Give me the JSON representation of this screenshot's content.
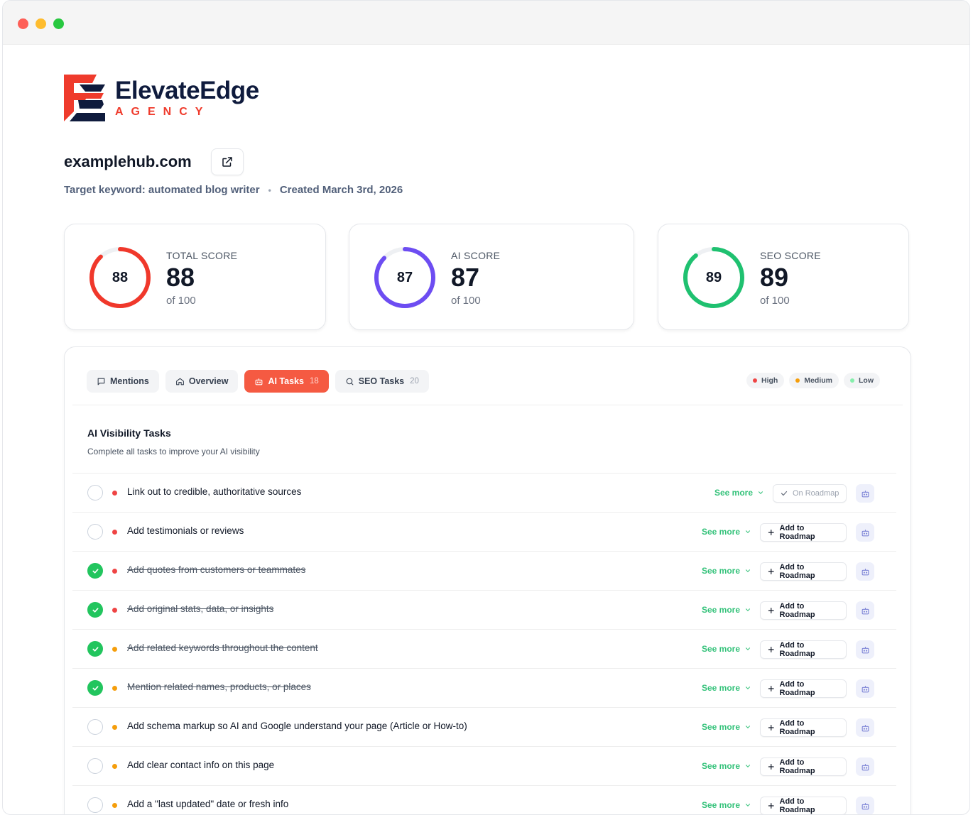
{
  "window": {
    "title": ""
  },
  "brand": {
    "name": "ElevateEdge",
    "tagline": "AGENCY"
  },
  "site": {
    "domain": "examplehub.com",
    "target_keyword": "Target keyword: automated blog writer",
    "created": "Created March 3rd, 2026"
  },
  "scores": [
    {
      "label": "TOTAL SCORE",
      "value": "88",
      "of": "of 100",
      "percent": 88,
      "color": "#f0382b"
    },
    {
      "label": "AI SCORE",
      "value": "87",
      "of": "of 100",
      "percent": 87,
      "color": "#6d4df2"
    },
    {
      "label": "SEO SCORE",
      "value": "89",
      "of": "of 100",
      "percent": 89,
      "color": "#1fc170"
    }
  ],
  "tabs": [
    {
      "label": "Mentions",
      "count": "",
      "icon": "chat-bubble-icon",
      "active": false
    },
    {
      "label": "Overview",
      "count": "",
      "icon": "home-icon",
      "active": false
    },
    {
      "label": "AI Tasks",
      "count": "18",
      "icon": "robot-icon",
      "active": true
    },
    {
      "label": "SEO Tasks",
      "count": "20",
      "icon": "search-icon",
      "active": false
    }
  ],
  "legend": [
    {
      "label": "High",
      "color": "#ef4444"
    },
    {
      "label": "Medium",
      "color": "#f59e0b"
    },
    {
      "label": "Low",
      "color": "#86efac"
    }
  ],
  "section": {
    "title": "AI Visibility Tasks",
    "subtitle": "Complete all tasks to improve your AI visibility"
  },
  "see_more_label": "See more",
  "tasks": [
    {
      "text": "Link out to credible, authoritative sources",
      "done": false,
      "priority": "high",
      "roadmap": "On Roadmap",
      "on_roadmap": true
    },
    {
      "text": "Add testimonials or reviews",
      "done": false,
      "priority": "high",
      "roadmap": "Add to Roadmap",
      "on_roadmap": false
    },
    {
      "text": "Add quotes from customers or teammates",
      "done": true,
      "priority": "high",
      "roadmap": "Add to Roadmap",
      "on_roadmap": false
    },
    {
      "text": "Add original stats, data, or insights",
      "done": true,
      "priority": "high",
      "roadmap": "Add to Roadmap",
      "on_roadmap": false
    },
    {
      "text": "Add related keywords throughout the content",
      "done": true,
      "priority": "medium",
      "roadmap": "Add to Roadmap",
      "on_roadmap": false
    },
    {
      "text": "Mention related names, products, or places",
      "done": true,
      "priority": "medium",
      "roadmap": "Add to Roadmap",
      "on_roadmap": false
    },
    {
      "text": "Add schema markup so AI and Google understand your page (Article or How-to)",
      "done": false,
      "priority": "medium",
      "roadmap": "Add to Roadmap",
      "on_roadmap": false
    },
    {
      "text": "Add clear contact info on this page",
      "done": false,
      "priority": "medium",
      "roadmap": "Add to Roadmap",
      "on_roadmap": false
    },
    {
      "text": "Add a \"last updated\" date or fresh info",
      "done": false,
      "priority": "medium",
      "roadmap": "Add to Roadmap",
      "on_roadmap": false
    }
  ],
  "colors": {
    "high": "#ef4444",
    "medium": "#f59e0b",
    "low": "#86efac",
    "accent": "#f55a42",
    "done": "#22c55e",
    "see_more": "#34c27a"
  }
}
